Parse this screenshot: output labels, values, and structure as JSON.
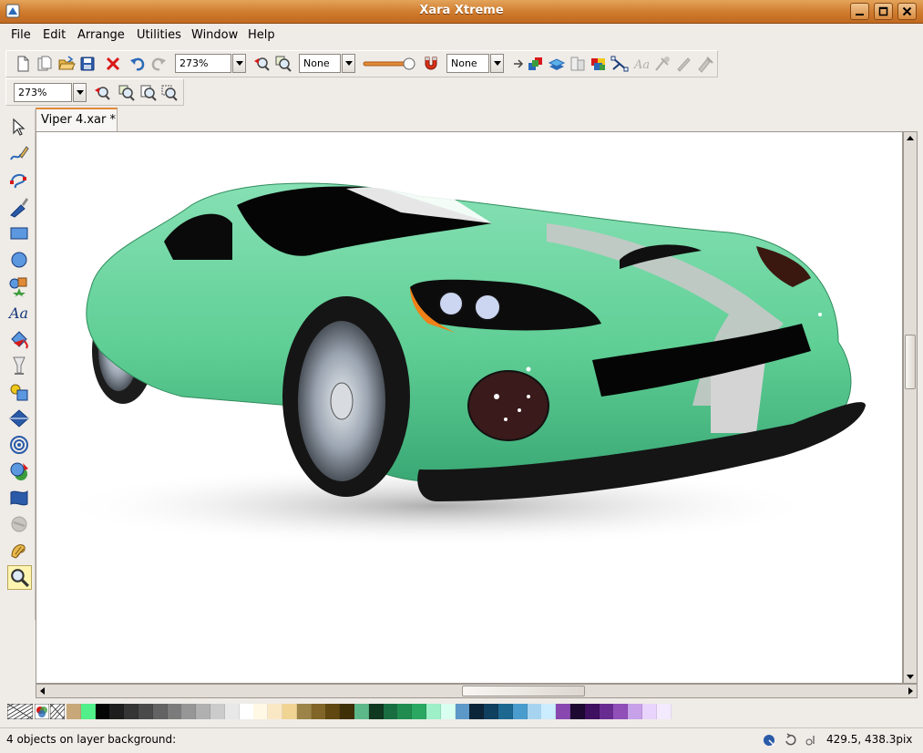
{
  "window": {
    "title": "Xara Xtreme"
  },
  "menu": {
    "items": [
      {
        "label": "File"
      },
      {
        "label": "Edit"
      },
      {
        "label": "Arrange"
      },
      {
        "label": "Utilities"
      },
      {
        "label": "Window"
      },
      {
        "label": "Help"
      }
    ]
  },
  "toolbar": {
    "zoom_value": "273%",
    "line_width": "None",
    "feather": "None"
  },
  "toolbar2": {
    "zoom_value": "273%"
  },
  "document": {
    "tab_label": "Viper 4.xar *"
  },
  "status": {
    "message": "4 objects on layer background:",
    "coords": "429.5, 438.3pix"
  },
  "palette": {
    "colors": [
      "#c8a878",
      "#52f08a",
      "#050505",
      "#1e1e1e",
      "#353535",
      "#4a4a4a",
      "#636363",
      "#7b7b7b",
      "#969696",
      "#b0b0b0",
      "#cbcbcb",
      "#e8e8e8",
      "#ffffff",
      "#fff8e4",
      "#fae8c4",
      "#f0d494",
      "#9c8448",
      "#806428",
      "#604810",
      "#403008",
      "#5cb888",
      "#103820",
      "#186e40",
      "#208c50",
      "#2aa862",
      "#9ef0c8",
      "#d8fff0",
      "#5c98c8",
      "#0c2438",
      "#104060",
      "#1c6890",
      "#4a9ccc",
      "#a6d4f0",
      "#ccecff",
      "#8848b0",
      "#1c0830",
      "#401060",
      "#682c90",
      "#9050b8",
      "#c6a0e8",
      "#e8d4fc",
      "#f4eaff"
    ]
  },
  "colors": {
    "accent": "#e08a38",
    "car": "#5fcf95"
  }
}
